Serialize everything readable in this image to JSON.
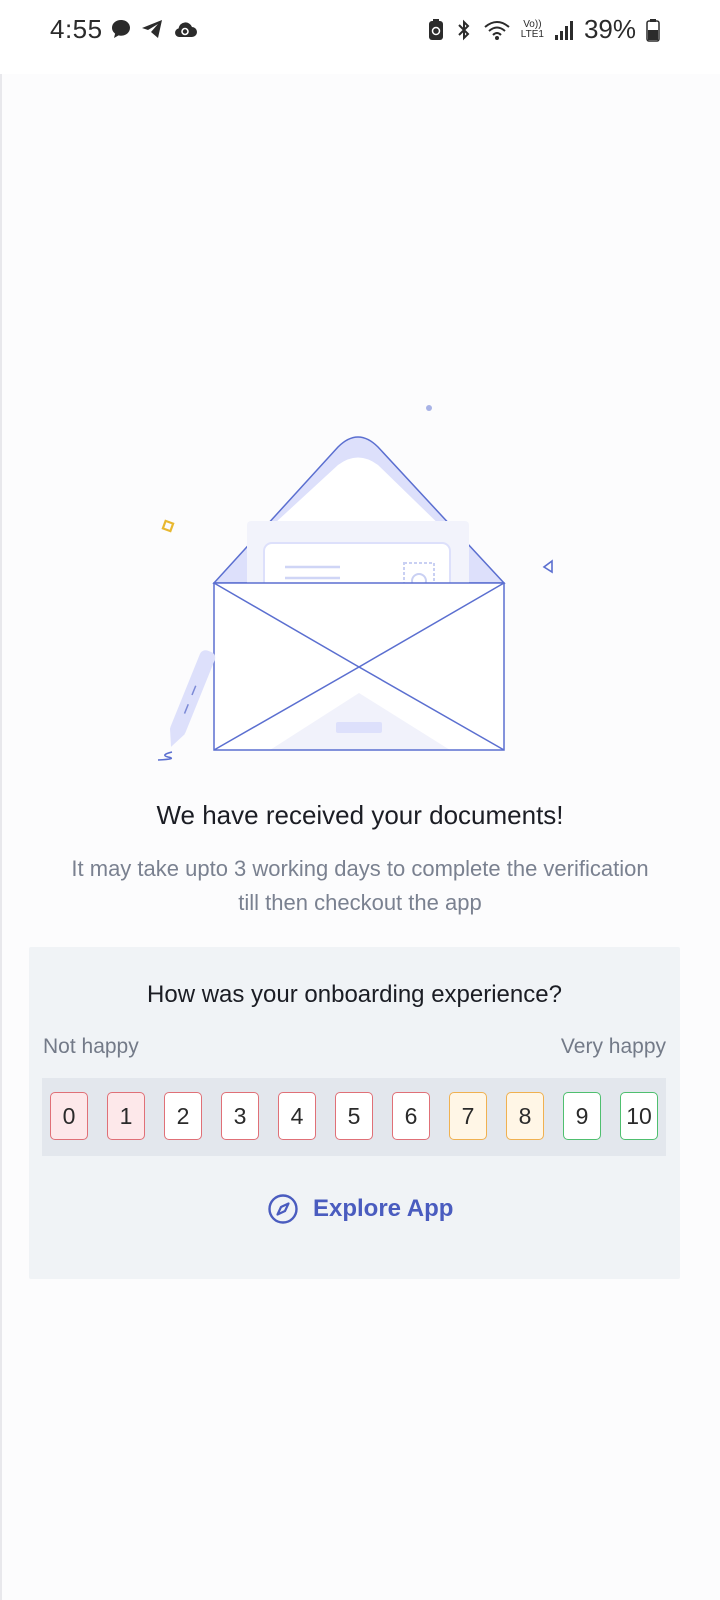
{
  "status_bar": {
    "time": "4:55",
    "battery_percent": "39%",
    "network_top": "Vo))",
    "network_bottom": "LTE1"
  },
  "confirmation": {
    "headline": "We have received your documents!",
    "subtext_line1": "It may take upto 3 working days to complete the verification",
    "subtext_line2": "till then checkout the app"
  },
  "feedback": {
    "question": "How was your onboarding experience?",
    "low_label": "Not happy",
    "high_label": "Very happy",
    "ratings": [
      "0",
      "1",
      "2",
      "3",
      "4",
      "5",
      "6",
      "7",
      "8",
      "9",
      "10"
    ]
  },
  "explore_button": {
    "label": "Explore App",
    "icon": "compass-icon"
  },
  "colors": {
    "accent": "#4a5cbf",
    "rating_red": "#e07077",
    "rating_orange": "#f0b150",
    "rating_green": "#4fbf6f",
    "card_bg": "#f0f3f6"
  }
}
